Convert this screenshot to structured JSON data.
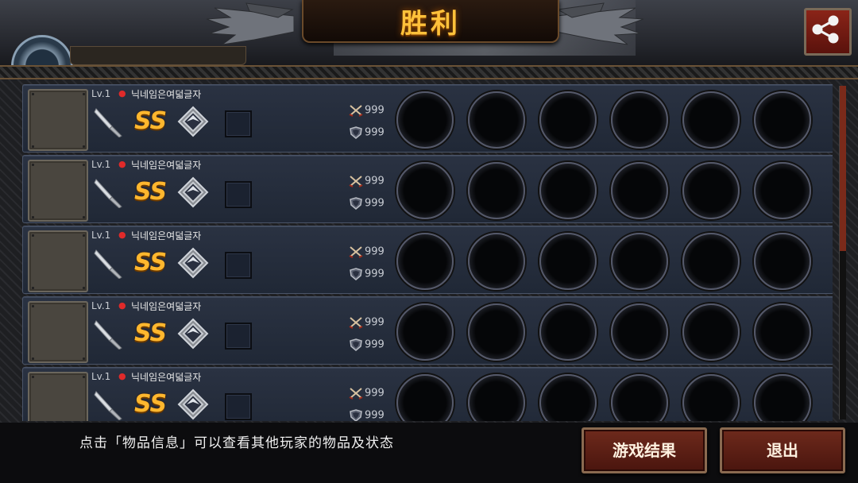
{
  "header": {
    "title": "胜利",
    "share_icon": "share-icon"
  },
  "players": [
    {
      "level": "Lv.1",
      "name": "닉네임은여덟글자",
      "grade": "SS",
      "attack": "999",
      "defense": "999"
    },
    {
      "level": "Lv.1",
      "name": "닉네임은여덟글자",
      "grade": "SS",
      "attack": "999",
      "defense": "999"
    },
    {
      "level": "Lv.1",
      "name": "닉네임은여덟글자",
      "grade": "SS",
      "attack": "999",
      "defense": "999"
    },
    {
      "level": "Lv.1",
      "name": "닉네임은여덟글자",
      "grade": "SS",
      "attack": "999",
      "defense": "999"
    },
    {
      "level": "Lv.1",
      "name": "닉네임은여덟글자",
      "grade": "SS",
      "attack": "999",
      "defense": "999"
    }
  ],
  "footer": {
    "hint": "点击「物品信息」可以查看其他玩家的物品及状态",
    "result_button": "游戏结果",
    "exit_button": "退出"
  },
  "colors": {
    "title": "#ffc13a",
    "grade": "#ffb72e",
    "button": "#6e2a1c",
    "row": "#2a3242"
  }
}
